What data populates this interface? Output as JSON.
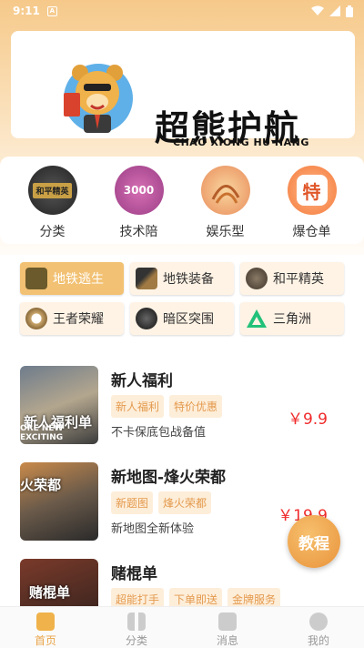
{
  "status_bar": {
    "time": "9:11",
    "notification_badge": "A"
  },
  "banner": {
    "brand_title": "超熊护航",
    "brand_subtitle": "CHAO XIONG HU HANG"
  },
  "categories": [
    {
      "label": "分类",
      "icon": "peace-elite-badge-icon"
    },
    {
      "label": "技术陪",
      "icon": "3000-badge-icon",
      "badge_text": "3000"
    },
    {
      "label": "娱乐型",
      "icon": "entertainment-icon"
    },
    {
      "label": "爆仓单",
      "icon": "special-char-icon",
      "badge_text": "特"
    }
  ],
  "game_tags": [
    {
      "label": "地铁逃生",
      "active": true
    },
    {
      "label": "地铁装备",
      "active": false
    },
    {
      "label": "和平精英",
      "active": false
    },
    {
      "label": "王者荣耀",
      "active": false
    },
    {
      "label": "暗区突围",
      "active": false
    },
    {
      "label": "三角洲",
      "active": false
    }
  ],
  "items": [
    {
      "title": "新人福利",
      "tags": [
        "新人福利",
        "特价优惠"
      ],
      "desc": "不卡保底包战备值",
      "price": "￥9.9",
      "thumb_text": "新人福利单",
      "thumb_sub": "ORE NEW EXCITING"
    },
    {
      "title": "新地图-烽火荣都",
      "tags": [
        "新题图",
        "烽火荣都"
      ],
      "desc": "新地图全新体验",
      "price": "￥19.9",
      "thumb_text": "火荣都"
    },
    {
      "title": "赌棍单",
      "tags": [
        "超能打手",
        "下单即送",
        "金牌服务"
      ],
      "desc": "",
      "price": "",
      "thumb_text": "赌棍单"
    }
  ],
  "tutorial_button": "教程",
  "tab_bar": [
    {
      "label": "首页",
      "active": true
    },
    {
      "label": "分类",
      "active": false
    },
    {
      "label": "消息",
      "active": false
    },
    {
      "label": "我的",
      "active": false
    }
  ],
  "colors": {
    "accent": "#f2c173",
    "price": "#f02b2b",
    "tag_text": "#e49a4e"
  }
}
